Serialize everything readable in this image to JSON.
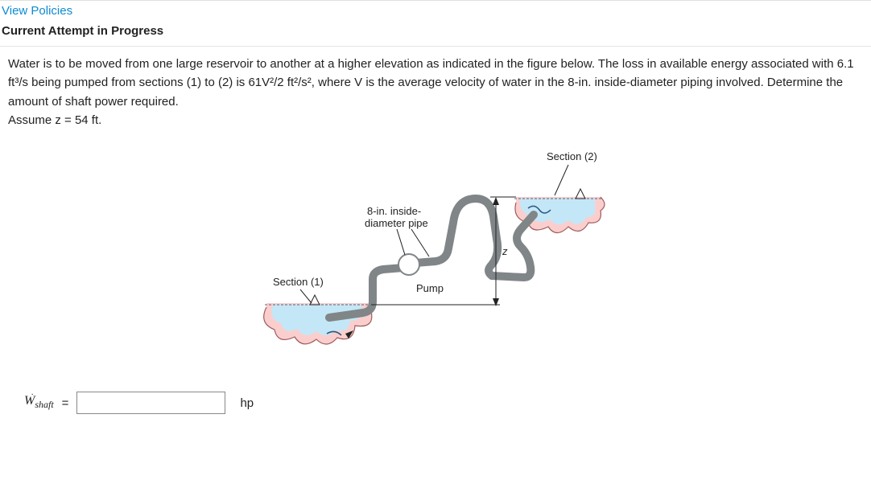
{
  "links": {
    "view_policies": "View Policies"
  },
  "heading": "Current Attempt in Progress",
  "problem": {
    "para1": "Water is to be moved from one large reservoir to another at a higher elevation as indicated in the figure below. The loss in available energy associated with 6.1 ft³/s being pumped from sections (1) to (2) is 61V²/2 ft²/s², where V is the average velocity of water in the 8-in. inside-diameter piping involved. Determine the amount of shaft power required.",
    "assume": "Assume z = 54 ft."
  },
  "diagram": {
    "section1": "Section (1)",
    "section2": "Section (2)",
    "pipe_label_l1": "8-in. inside-",
    "pipe_label_l2": "diameter pipe",
    "pump": "Pump",
    "z": "z"
  },
  "answer": {
    "var_W": "W",
    "var_sub": "shaft",
    "equals": "=",
    "unit": "hp",
    "value": "",
    "placeholder": ""
  }
}
